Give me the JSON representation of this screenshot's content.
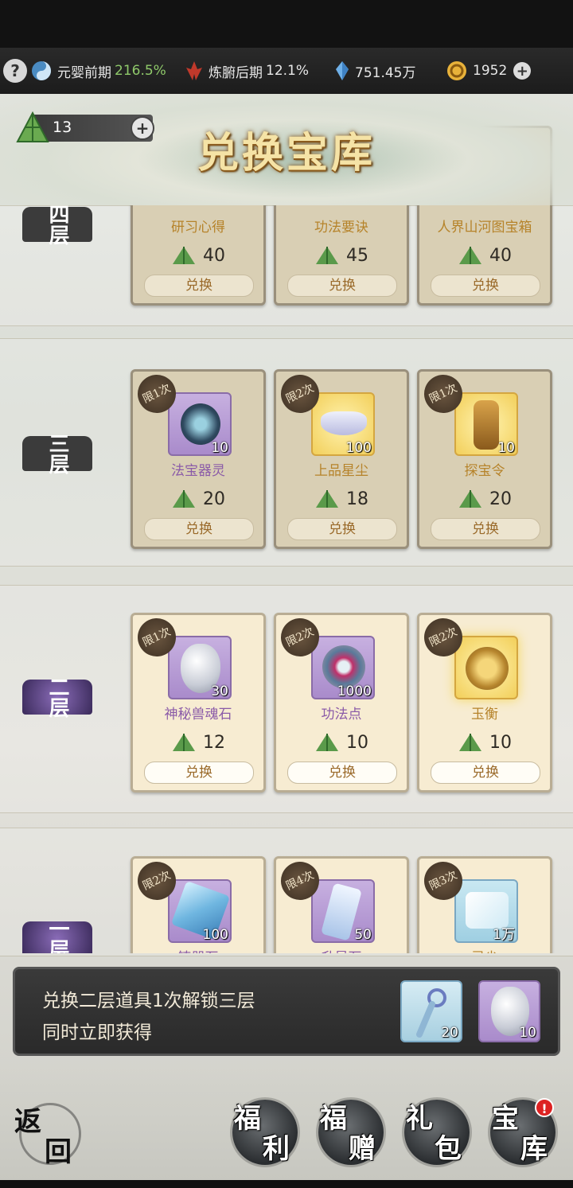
{
  "resources": {
    "realm1_label": "元婴前期",
    "realm1_pct": "216.5%",
    "realm2_label": "炼腑后期",
    "realm2_pct": "12.1%",
    "spirit_stone": "751.45万",
    "gold": "1952"
  },
  "header": {
    "title": "兑换宝库",
    "zongzi_count": "13"
  },
  "floors": {
    "four_label": "四层",
    "three_label": "三层",
    "two_label": "二层",
    "one_label": "一层"
  },
  "floor4_items": [
    {
      "name": "研习心得",
      "price": "40",
      "btn": "兑换"
    },
    {
      "name": "功法要诀",
      "price": "45",
      "btn": "兑换"
    },
    {
      "name": "人界山河图宝箱",
      "price": "40",
      "btn": "兑换"
    }
  ],
  "floor3_items": [
    {
      "limit": "限1次",
      "count": "10",
      "name": "法宝器灵",
      "price": "20",
      "btn": "兑换"
    },
    {
      "limit": "限2次",
      "count": "100",
      "name": "上品星尘",
      "price": "18",
      "btn": "兑换"
    },
    {
      "limit": "限1次",
      "count": "10",
      "name": "探宝令",
      "price": "20",
      "btn": "兑换"
    }
  ],
  "floor2_items": [
    {
      "limit": "限1次",
      "count": "30",
      "name": "神秘兽魂石",
      "price": "12",
      "btn": "兑换"
    },
    {
      "limit": "限2次",
      "count": "1000",
      "name": "功法点",
      "price": "10",
      "btn": "兑换"
    },
    {
      "limit": "限2次",
      "count": "",
      "name": "玉衡",
      "price": "10",
      "btn": "兑换"
    }
  ],
  "floor1_items": [
    {
      "limit": "限2次",
      "count": "100",
      "name": "铸器石"
    },
    {
      "limit": "限4次",
      "count": "50",
      "name": "升星石"
    },
    {
      "limit": "限3次",
      "count": "1万",
      "name": "灵尘"
    }
  ],
  "unlock": {
    "line1": "兑换二层道具1次解锁三层",
    "line2": "同时立即获得",
    "reward1_count": "20",
    "reward2_count": "10"
  },
  "nav": {
    "back_top": "返",
    "back_bottom": "回",
    "welfare_a": "福",
    "welfare_b": "利",
    "gift_a": "福",
    "gift_b": "赠",
    "pack_a": "礼",
    "pack_b": "包",
    "vault_a": "宝",
    "vault_b": "库",
    "vault_badge": "!"
  },
  "colors": {
    "accent_gold": "#f5e3a6",
    "price_green": "#5a9a4a",
    "status_green": "#8fc96a"
  }
}
